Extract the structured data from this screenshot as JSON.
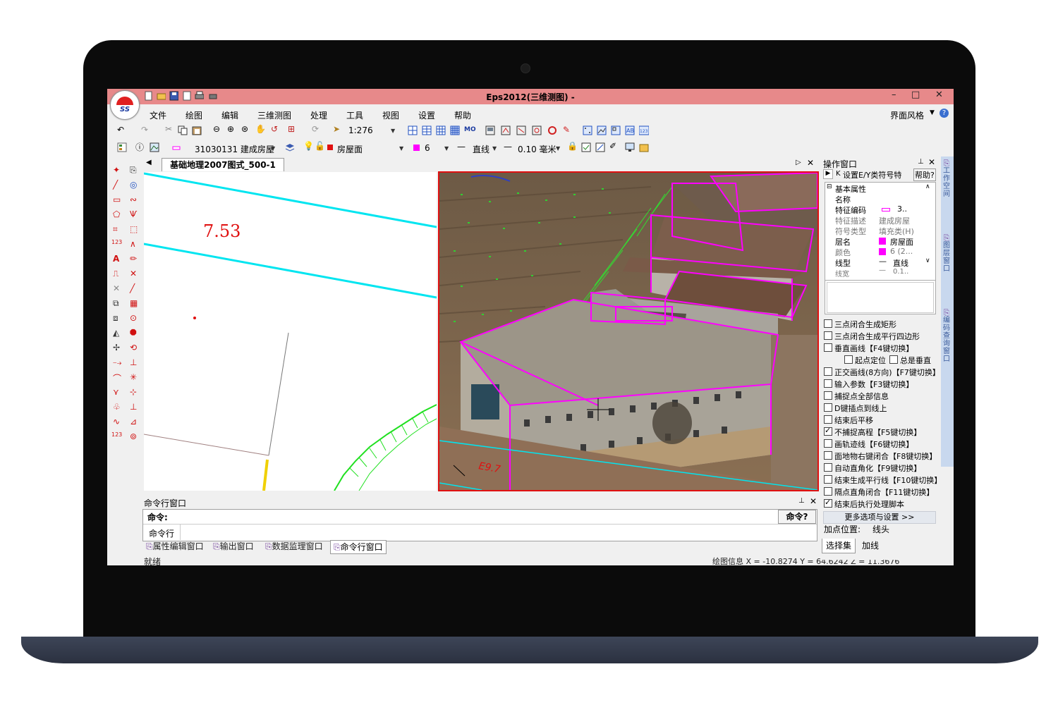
{
  "window": {
    "title": "Eps2012(三维测图) -",
    "ui_style_label": "界面风格",
    "logo_text": "SS"
  },
  "menu": [
    "文件",
    "绘图",
    "编辑",
    "三维测图",
    "处理",
    "工具",
    "视图",
    "设置",
    "帮助"
  ],
  "toolbar1": {
    "scale_value": "1:276",
    "mo_label": "MO"
  },
  "toolbar2": {
    "feature_code": "31030131 建成房屋",
    "layer_name": "房屋面",
    "color_value": "6",
    "line_type": "直线",
    "line_width": "0.10 毫米"
  },
  "document_tab": "基础地理2007图式_500-1",
  "canvas": {
    "elevation_label": "7.53"
  },
  "view3d": {
    "overlay_label": "7.53"
  },
  "command_window": {
    "title": "命令行窗口",
    "prompt_label": "命令:",
    "help_button": "命令?",
    "input_label": "命令行"
  },
  "bottom_tabs": [
    "属性编辑窗口",
    "输出窗口",
    "数据监理窗口",
    "命令行窗口"
  ],
  "status": {
    "ready": "就绪",
    "coords": "绘图信息 X = -10.8274 Y = 64.6242 Z = 11.3676"
  },
  "operation_panel": {
    "title": "操作窗口",
    "toolbar_text": "设置E/Y类符号特",
    "help_label": "帮助?",
    "group_label": "基本属性",
    "properties": [
      {
        "name": "名称",
        "value": ""
      },
      {
        "name": "特征编码",
        "value": "3.."
      },
      {
        "name": "特征描述",
        "value": "建成房屋"
      },
      {
        "name": "符号类型",
        "value": "填充类(H)"
      },
      {
        "name": "层名",
        "value": "房屋面"
      },
      {
        "name": "颜色",
        "value": "6 (2..."
      },
      {
        "name": "线型",
        "value": "直线"
      },
      {
        "name": "线宽",
        "value": "0.1.."
      }
    ],
    "options": [
      {
        "label": "三点闭合生成矩形",
        "checked": false
      },
      {
        "label": "三点闭合生成平行四边形",
        "checked": false
      },
      {
        "label": "垂直画线【F4键切换】",
        "checked": false
      },
      {
        "label": "正交画线(8方向)【F7键切换】",
        "checked": false
      },
      {
        "label": "输入参数【F3键切换】",
        "checked": false
      },
      {
        "label": "捕捉点全部信息",
        "checked": false
      },
      {
        "label": "D键插点到线上",
        "checked": false
      },
      {
        "label": "结束后平移",
        "checked": false
      },
      {
        "label": "不捕捉高程【F5键切换】",
        "checked": true
      },
      {
        "label": "画轨迹线【F6键切换】",
        "checked": false
      },
      {
        "label": "面地物右键闭合【F8键切换】",
        "checked": false
      },
      {
        "label": "自动直角化【F9键切换】",
        "checked": false
      },
      {
        "label": "结束生成平行线【F10键切换】",
        "checked": false
      },
      {
        "label": "隔点直角闭合【F11键切换】",
        "checked": false
      },
      {
        "label": "结束后执行处理脚本",
        "checked": true
      }
    ],
    "sub_options": [
      {
        "label": "起点定位",
        "checked": false
      },
      {
        "label": "总是垂直",
        "checked": false
      }
    ],
    "more_button": "更多选项与设置 >>",
    "add_point_label": "加点位置:",
    "add_point_value": "线头",
    "tabs": [
      "选择集",
      "加线"
    ]
  },
  "side_tabs": [
    "工作空间",
    "图层窗口",
    "编码查询窗口"
  ],
  "colors": {
    "titlebar": "#e7898a",
    "canvas_line": "#00e5f0",
    "building_outline": "#ff00ff",
    "view_border": "#e01010"
  }
}
